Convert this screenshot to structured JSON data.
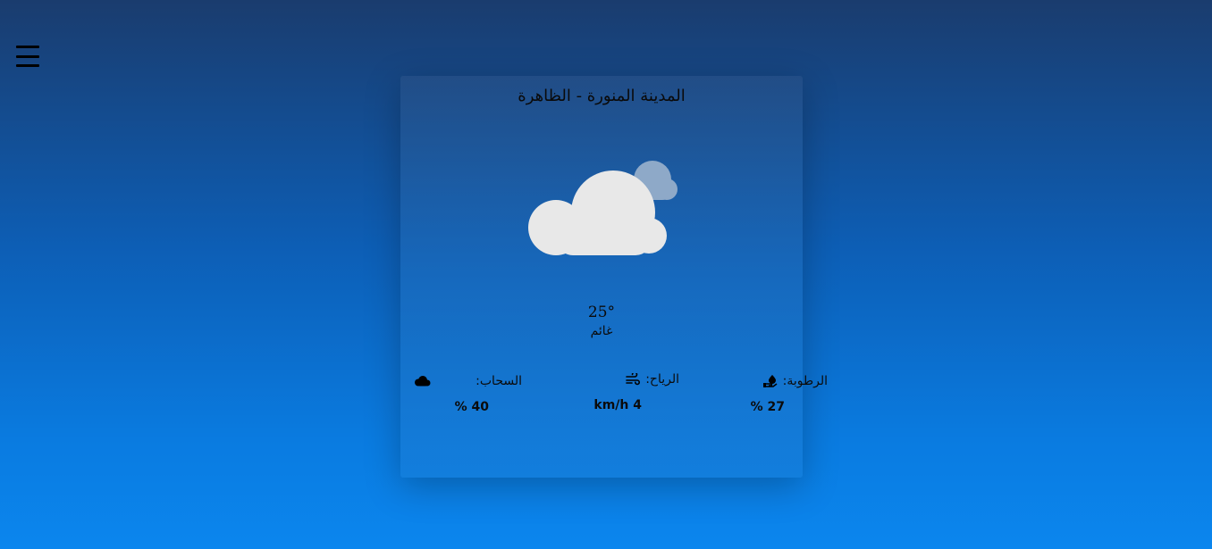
{
  "menu": {
    "icon": "hamburger-menu-icon"
  },
  "weather": {
    "city": "المدينة المنورة - الظاهرة",
    "icon": "partly-cloudy-icon",
    "temperature": "25°",
    "condition": "غائم",
    "stats": {
      "humidity": {
        "label": "الرطوبة:",
        "value": "27 %",
        "icon": "humidity-hand-droplet-icon"
      },
      "wind": {
        "label": "الرياح:",
        "value": "4 km/h",
        "icon": "wind-icon"
      },
      "clouds": {
        "label": "السحاب:",
        "value": "40 %",
        "icon": "cloud-icon"
      }
    }
  },
  "colors": {
    "background_top": "#1a3c6e",
    "background_bottom": "#0b86ee",
    "cloud_main": "#e8e8e8",
    "cloud_back": "#8ea9c8"
  }
}
